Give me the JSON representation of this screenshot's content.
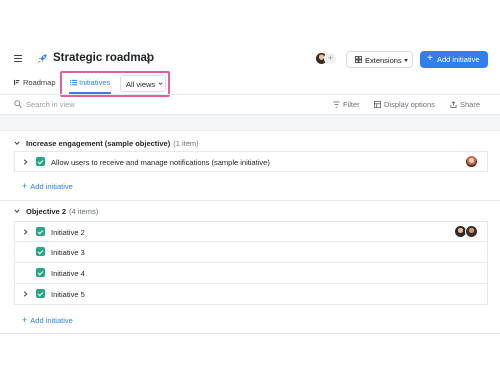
{
  "header": {
    "title": "Strategic roadmap",
    "extensions_label": "Extensions",
    "add_initiative_label": "Add initiative",
    "avatar_more": "+"
  },
  "views": {
    "roadmap_label": "Roadmap",
    "initiatives_label": "Initiatives",
    "all_views_label": "All views"
  },
  "toolbar": {
    "search_placeholder": "Search in view",
    "filter_label": "Filter",
    "display_options_label": "Display options",
    "share_label": "Share"
  },
  "groups": [
    {
      "name": "Increase engagement (sample objective)",
      "count": "(1 item)",
      "rows": [
        {
          "label": "Allow users to receive and manage notifications (sample initiative)"
        }
      ],
      "add_label": "Add initiative"
    },
    {
      "name": "Objective 2",
      "count": "(4 items)",
      "rows": [
        {
          "label": "Initiative 2"
        },
        {
          "label": "Initiative 3"
        },
        {
          "label": "Initiative 4"
        },
        {
          "label": "Initiative 5"
        }
      ],
      "add_label": "Add initiative"
    }
  ],
  "icons": {
    "menu": "hamburger-icon",
    "app": "rocket-icon",
    "more": "kebab-icon",
    "extensions": "puzzle-icon",
    "roadmap": "roadmap-icon",
    "initiatives": "list-icon",
    "search": "search-icon",
    "filter": "filter-icon",
    "display": "display-options-icon",
    "share": "share-icon",
    "initiative": "initiative-icon"
  },
  "colors": {
    "accent": "#2f80ed",
    "initiative": "#2ba588",
    "highlight": "#e0609a"
  }
}
